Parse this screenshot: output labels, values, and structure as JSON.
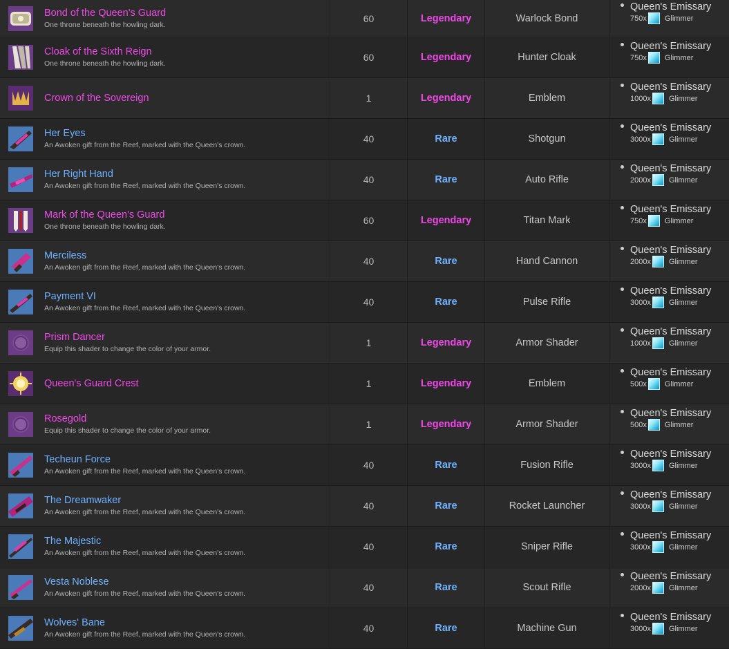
{
  "colors": {
    "legendary": "#f048e8",
    "rare": "#6fb2ff",
    "row_odd": "#2b2b2b",
    "row_even": "#262626"
  },
  "rows": [
    {
      "name": "Bond of the Queen's Guard",
      "desc": "One throne beneath the howling dark.",
      "level": "60",
      "rarity": "Legendary",
      "type": "Warlock Bond",
      "vendor": "Queen's Emissary",
      "amount": "750x",
      "currency": "Glimmer",
      "icon": "bond-icon"
    },
    {
      "name": "Cloak of the Sixth Reign",
      "desc": "One throne beneath the howling dark.",
      "level": "60",
      "rarity": "Legendary",
      "type": "Hunter Cloak",
      "vendor": "Queen's Emissary",
      "amount": "750x",
      "currency": "Glimmer",
      "icon": "cloak-icon"
    },
    {
      "name": "Crown of the Sovereign",
      "desc": "",
      "level": "1",
      "rarity": "Legendary",
      "type": "Emblem",
      "vendor": "Queen's Emissary",
      "amount": "1000x",
      "currency": "Glimmer",
      "icon": "crown-emblem-icon"
    },
    {
      "name": "Her Eyes",
      "desc": "An Awoken gift from the Reef, marked with the Queen's crown.",
      "level": "40",
      "rarity": "Rare",
      "type": "Shotgun",
      "vendor": "Queen's Emissary",
      "amount": "3000x",
      "currency": "Glimmer",
      "icon": "shotgun-icon"
    },
    {
      "name": "Her Right Hand",
      "desc": "An Awoken gift from the Reef, marked with the Queen's crown.",
      "level": "40",
      "rarity": "Rare",
      "type": "Auto Rifle",
      "vendor": "Queen's Emissary",
      "amount": "2000x",
      "currency": "Glimmer",
      "icon": "auto-rifle-icon"
    },
    {
      "name": "Mark of the Queen's Guard",
      "desc": "One throne beneath the howling dark.",
      "level": "60",
      "rarity": "Legendary",
      "type": "Titan Mark",
      "vendor": "Queen's Emissary",
      "amount": "750x",
      "currency": "Glimmer",
      "icon": "mark-icon"
    },
    {
      "name": "Merciless",
      "desc": "An Awoken gift from the Reef, marked with the Queen's crown.",
      "level": "40",
      "rarity": "Rare",
      "type": "Hand Cannon",
      "vendor": "Queen's Emissary",
      "amount": "2000x",
      "currency": "Glimmer",
      "icon": "hand-cannon-icon"
    },
    {
      "name": "Payment VI",
      "desc": "An Awoken gift from the Reef, marked with the Queen's crown.",
      "level": "40",
      "rarity": "Rare",
      "type": "Pulse Rifle",
      "vendor": "Queen's Emissary",
      "amount": "3000x",
      "currency": "Glimmer",
      "icon": "pulse-rifle-icon"
    },
    {
      "name": "Prism Dancer",
      "desc": "Equip this shader to change the color of your armor.",
      "level": "1",
      "rarity": "Legendary",
      "type": "Armor Shader",
      "vendor": "Queen's Emissary",
      "amount": "1000x",
      "currency": "Glimmer",
      "icon": "shader-icon"
    },
    {
      "name": "Queen's Guard Crest",
      "desc": "",
      "level": "1",
      "rarity": "Legendary",
      "type": "Emblem",
      "vendor": "Queen's Emissary",
      "amount": "500x",
      "currency": "Glimmer",
      "icon": "crest-emblem-icon"
    },
    {
      "name": "Rosegold",
      "desc": "Equip this shader to change the color of your armor.",
      "level": "1",
      "rarity": "Legendary",
      "type": "Armor Shader",
      "vendor": "Queen's Emissary",
      "amount": "500x",
      "currency": "Glimmer",
      "icon": "shader-icon"
    },
    {
      "name": "Techeun Force",
      "desc": "An Awoken gift from the Reef, marked with the Queen's crown.",
      "level": "40",
      "rarity": "Rare",
      "type": "Fusion Rifle",
      "vendor": "Queen's Emissary",
      "amount": "3000x",
      "currency": "Glimmer",
      "icon": "fusion-rifle-icon"
    },
    {
      "name": "The Dreamwaker",
      "desc": "An Awoken gift from the Reef, marked with the Queen's crown.",
      "level": "40",
      "rarity": "Rare",
      "type": "Rocket Launcher",
      "vendor": "Queen's Emissary",
      "amount": "3000x",
      "currency": "Glimmer",
      "icon": "rocket-launcher-icon"
    },
    {
      "name": "The Majestic",
      "desc": "An Awoken gift from the Reef, marked with the Queen's crown.",
      "level": "40",
      "rarity": "Rare",
      "type": "Sniper Rifle",
      "vendor": "Queen's Emissary",
      "amount": "3000x",
      "currency": "Glimmer",
      "icon": "sniper-rifle-icon"
    },
    {
      "name": "Vesta Noblese",
      "desc": "An Awoken gift from the Reef, marked with the Queen's crown.",
      "level": "40",
      "rarity": "Rare",
      "type": "Scout Rifle",
      "vendor": "Queen's Emissary",
      "amount": "2000x",
      "currency": "Glimmer",
      "icon": "scout-rifle-icon"
    },
    {
      "name": "Wolves' Bane",
      "desc": "An Awoken gift from the Reef, marked with the Queen's crown.",
      "level": "40",
      "rarity": "Rare",
      "type": "Machine Gun",
      "vendor": "Queen's Emissary",
      "amount": "3000x",
      "currency": "Glimmer",
      "icon": "machine-gun-icon"
    }
  ]
}
